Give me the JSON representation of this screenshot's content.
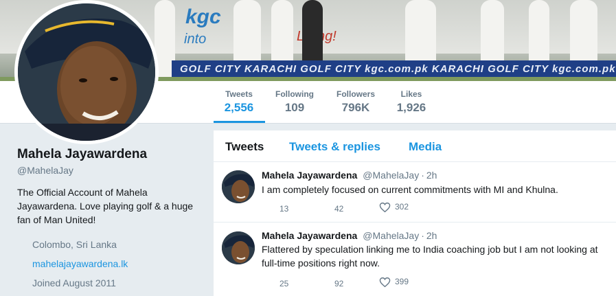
{
  "banner": {
    "sign_text": "kgc",
    "sign_text_2": "into",
    "sign_text_3": "Living!",
    "board_text": "GOLF CITY  KARACHI  GOLF CITY  kgc.com.pk  KARACHI  GOLF CITY  kgc.com.pk  KARACHI"
  },
  "stats": [
    {
      "label": "Tweets",
      "value": "2,556"
    },
    {
      "label": "Following",
      "value": "109"
    },
    {
      "label": "Followers",
      "value": "796K"
    },
    {
      "label": "Likes",
      "value": "1,926"
    }
  ],
  "profile": {
    "name": "Mahela Jayawardena",
    "handle": "@MahelaJay",
    "bio": "The Official Account of Mahela Jayawardena. Love playing golf & a huge fan of Man United!",
    "location": "Colombo, Sri Lanka",
    "website": "mahelajayawardena.lk",
    "joined": "Joined August 2011"
  },
  "tabs": [
    {
      "label": "Tweets"
    },
    {
      "label": "Tweets & replies"
    },
    {
      "label": "Media"
    }
  ],
  "tweets": [
    {
      "name": "Mahela Jayawardena",
      "handle": "@MahelaJay",
      "dot": "·",
      "time": "2h",
      "text": "I am completely focused on current commitments with MI and Khulna.",
      "replies": "13",
      "retweets": "42",
      "likes": "302"
    },
    {
      "name": "Mahela Jayawardena",
      "handle": "@MahelaJay",
      "dot": "·",
      "time": "2h",
      "text": "Flattered by speculation linking me to India coaching job but I am not looking at full-time positions right now.",
      "replies": "25",
      "retweets": "92",
      "likes": "399"
    }
  ],
  "colors": {
    "accent": "#1b95e0",
    "background": "#e6ecf0",
    "muted": "#657786"
  }
}
